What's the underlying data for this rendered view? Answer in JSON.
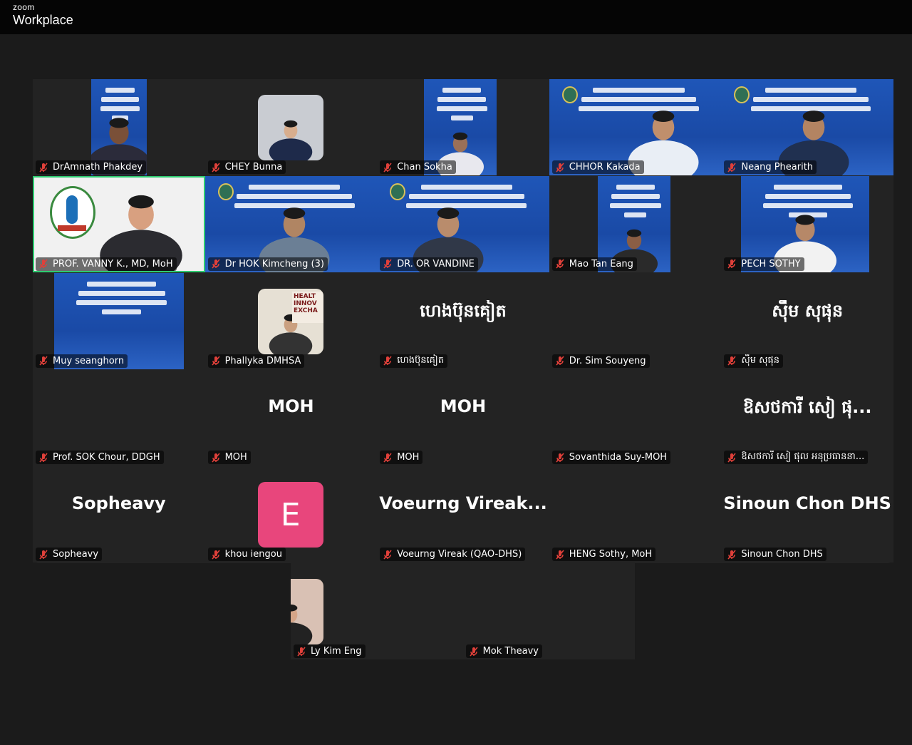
{
  "app": {
    "brand_small": "zoom",
    "brand_large": "Workplace"
  },
  "colors": {
    "active_speaker": "#2ecc71",
    "tile_bg": "#232323",
    "muted_icon": "#e0403a",
    "avatar_pink": "#e8467c"
  },
  "participants": [
    {
      "name": "DrAmnath Phakdey",
      "muted": true,
      "video": "banner-person"
    },
    {
      "name": "CHEY Bunna",
      "muted": true,
      "video": "photo"
    },
    {
      "name": "Chan Sokha",
      "muted": true,
      "video": "banner-person"
    },
    {
      "name": "CHHOR Kakada",
      "muted": true,
      "video": "banner-person"
    },
    {
      "name": "Neang Phearith",
      "muted": true,
      "video": "banner-person"
    },
    {
      "name": "PROF. VANNY K., MD, MoH",
      "muted": true,
      "video": "speaker",
      "active": true
    },
    {
      "name": "Dr HOK Kimcheng (3)",
      "muted": true,
      "video": "banner-person"
    },
    {
      "name": "DR. OR VANDINE",
      "muted": true,
      "video": "banner-person"
    },
    {
      "name": "Mao Tan Eang",
      "muted": true,
      "video": "banner-person"
    },
    {
      "name": "PECH SOTHY",
      "muted": true,
      "video": "banner-person"
    },
    {
      "name": "Muy seanghorn",
      "muted": true,
      "video": "banner"
    },
    {
      "name": "Phallyka DMHSA",
      "muted": true,
      "video": "photo"
    },
    {
      "name": "ហេងប៊ុនគៀត",
      "muted": true,
      "video": "none",
      "display": "ហេងប៊ុនគៀត"
    },
    {
      "name": "Dr. Sim Souyeng",
      "muted": true,
      "video": "photo"
    },
    {
      "name": "ស៊ឹម សុផុន",
      "muted": true,
      "video": "none",
      "display": "ស៊ឹម សុផុន"
    },
    {
      "name": "Prof. SOK Chour, DDGH",
      "muted": true,
      "video": "photo"
    },
    {
      "name": "MOH",
      "muted": true,
      "video": "none",
      "display": "MOH"
    },
    {
      "name": "MOH",
      "muted": true,
      "video": "none",
      "display": "MOH"
    },
    {
      "name": "Sovanthida Suy-MOH",
      "muted": true,
      "video": "photo"
    },
    {
      "name": "ឱសថការី សៀ ផុល អនុប្រធាននា...",
      "muted": true,
      "video": "none",
      "display": "ឱសថការី សៀ ផុ..."
    },
    {
      "name": "Sopheavy",
      "muted": true,
      "video": "none",
      "display": "Sopheavy"
    },
    {
      "name": "khou iengou",
      "muted": true,
      "video": "avatar",
      "letter": "E"
    },
    {
      "name": "Voeurng Vireak (QAO-DHS)",
      "muted": true,
      "video": "none",
      "display": "Voeurng  Vireak..."
    },
    {
      "name": "HENG Sothy, MoH",
      "muted": true,
      "video": "photo"
    },
    {
      "name": "Sinoun Chon DHS",
      "muted": true,
      "video": "none",
      "display": "Sinoun Chon DHS"
    },
    {
      "name": "Ly Kim Eng",
      "muted": true,
      "video": "photo"
    },
    {
      "name": "Mok Theavy",
      "muted": true,
      "video": "banner"
    }
  ]
}
